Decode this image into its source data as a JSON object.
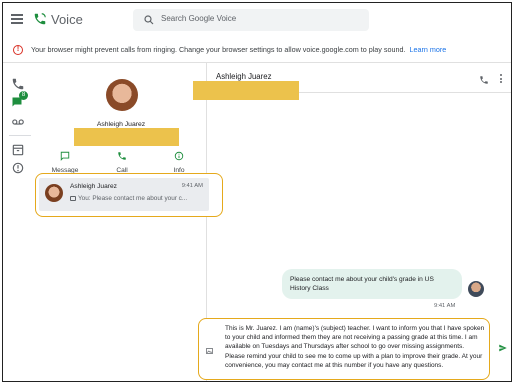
{
  "app": {
    "title": "Voice"
  },
  "search": {
    "placeholder": "Search Google Voice"
  },
  "banner": {
    "text": "Your browser might prevent calls from ringing. Change your browser settings to allow voice.google.com to play sound.",
    "link": "Learn more"
  },
  "rail": {
    "messages_badge": "8"
  },
  "contact": {
    "name": "Ashleigh Juarez",
    "actions": [
      {
        "label": "Message"
      },
      {
        "label": "Call"
      },
      {
        "label": "Info"
      }
    ]
  },
  "thread": {
    "name": "Ashleigh Juarez",
    "time": "9:41 AM",
    "snippet": "You: Please contact me about your c..."
  },
  "conversation": {
    "title": "Ashleigh Juarez",
    "messages": [
      {
        "text": "Please contact me about your child's grade in US History Class",
        "time": "9:41 AM"
      }
    ],
    "draft": "This is Mr. Juarez. I am (name)'s (subject) teacher. I want to inform you that I have spoken to your child and informed them they are not receiving a passing grade at this time. I am available on Tuesdays and Thursdays after school to go over missing assignments. Please remind your child to see me to come up with a plan to improve their grade. At your convenience, you may contact me at this number if you have any questions."
  },
  "colors": {
    "brand_green": "#1e8e3e",
    "highlight": "#e5a91c",
    "redaction": "#ecc24c",
    "outgoing_bubble": "#e3f2ed",
    "warning": "#d93025",
    "link": "#1a73e8"
  }
}
